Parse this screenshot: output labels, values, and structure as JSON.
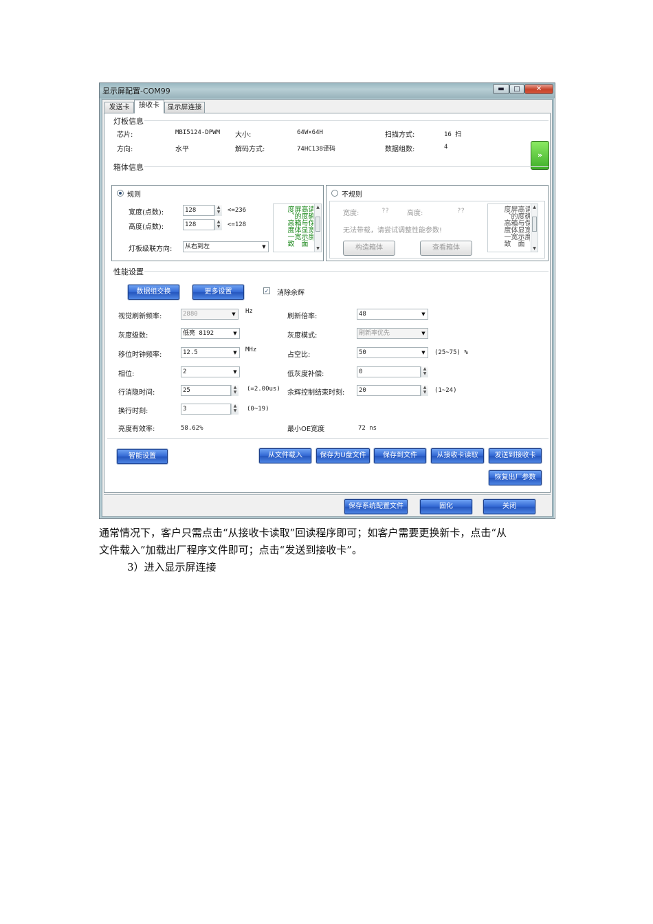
{
  "window": {
    "title": "显示屏配置-COM99",
    "minimize_icon": "minimize-icon",
    "maximize_icon": "maximize-icon",
    "close_icon": "close-icon",
    "minimize_label": "▬",
    "maximize_label": "□",
    "close_label": "✕"
  },
  "tabs": [
    {
      "label": "发送卡"
    },
    {
      "label": "接收卡"
    },
    {
      "label": "显示屏连接"
    }
  ],
  "lamp_info": {
    "title": "灯板信息",
    "chip_label": "芯片:",
    "chip_value": "MBI5124-DPWM",
    "size_label": "大小:",
    "size_value": "64W×64H",
    "scan_label": "扫描方式:",
    "scan_value": "16 扫",
    "direction_label": "方向:",
    "direction_value": "水平",
    "decode_label": "解码方式:",
    "decode_value": "74HC138译码",
    "data_groups_label": "数据组数:",
    "data_groups_value": "4",
    "next_button_label": "»"
  },
  "box_info": {
    "title": "箱体信息",
    "regular": {
      "label": "规则",
      "width_label": "宽度(点数):",
      "width_value": "128",
      "width_limit": "<=236",
      "height_label": "高度(点数):",
      "height_value": "128",
      "height_limit": "<=128",
      "cascade_label": "灯板级联方向:",
      "cascade_value": "从右到左",
      "hint_text": "请确保宽度、高度与显示面屏的箱体宽度、高度一致"
    },
    "irregular": {
      "label": "不规则",
      "width_label": "宽度:",
      "width_value": "??",
      "height_label": "高度:",
      "height_value": "??",
      "warning": "无法带载，请尝试调整性能参数!",
      "construct_button": "构造箱体",
      "view_button": "查看箱体",
      "hint_text": "请确保宽度、高度与显示面屏的箱体宽度、高度一致"
    }
  },
  "performance": {
    "title": "性能设置",
    "data_swap_button": "数据组交换",
    "more_settings_button": "更多设置",
    "ghost_checkbox_label": "消除余辉",
    "ghost_checked": true,
    "visual_refresh_label": "视觉刷新频率:",
    "visual_refresh_value": "2880",
    "visual_refresh_unit": "Hz",
    "refresh_multiple_label": "刷新倍率:",
    "refresh_multiple_value": "48",
    "gray_level_label": "灰度级数:",
    "gray_level_value": "低亮 8192",
    "gray_mode_label": "灰度模式:",
    "gray_mode_value": "刷新率优先",
    "shift_clock_label": "移位时钟频率:",
    "shift_clock_value": "12.5",
    "shift_clock_unit": "MHz",
    "duty_label": "占空比:",
    "duty_value": "50",
    "duty_range": "(25~75) %",
    "phase_label": "相位:",
    "phase_value": "2",
    "low_gray_label": "低灰度补偿:",
    "low_gray_value": "0",
    "blanking_label": "行消隐时间:",
    "blanking_value": "25",
    "blanking_note": "(=2.00us)",
    "afterglow_end_label": "余辉控制结束时刻:",
    "afterglow_end_value": "20",
    "afterglow_end_range": "(1~24)",
    "line_change_label": "换行时刻:",
    "line_change_value": "3",
    "line_change_range": "(0~19)",
    "brightness_eff_label": "亮度有效率:",
    "brightness_eff_value": "58.62%",
    "min_oe_label": "最小OE宽度",
    "min_oe_value": "72 ns"
  },
  "actions": {
    "smart_setup": "智能设置",
    "load_from_file": "从文件载入",
    "save_usb": "保存为U盘文件",
    "save_file": "保存到文件",
    "read_from_card": "从接收卡读取",
    "send_to_card": "发送到接收卡",
    "restore_factory": "恢复出厂参数"
  },
  "footer": {
    "save_system_config": "保存系统配置文件",
    "solidify": "固化",
    "close": "关闭"
  },
  "document": {
    "paragraph_line1": "通常情况下，客户只需点击“从接收卡读取”回读程序即可；如客户需要更换新卡，点击“从",
    "paragraph_line2": "文件载入”加载出厂程序文件即可；点击“发送到接收卡”。",
    "step_text": "3）进入显示屏连接"
  }
}
